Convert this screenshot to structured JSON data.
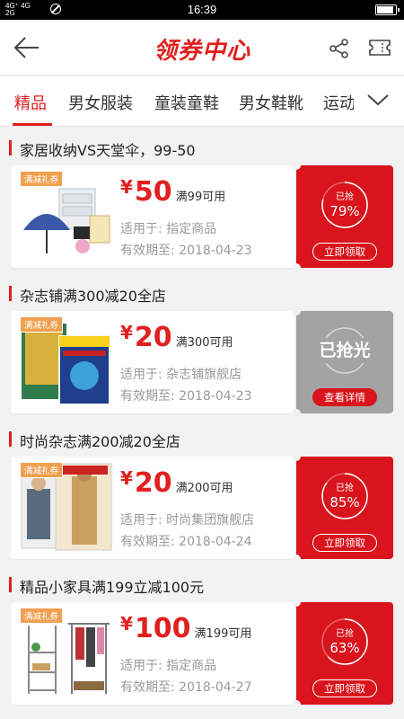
{
  "status_bar": {
    "signal1": "4G⁺ 4G",
    "signal2": "2G",
    "time": "16:39",
    "battery_level": 0.9
  },
  "header": {
    "logo": "领券中心",
    "icons": [
      "back-arrow-icon",
      "share-icon",
      "ticket-icon"
    ]
  },
  "tabs": [
    {
      "label": "精品",
      "active": true
    },
    {
      "label": "男女服装"
    },
    {
      "label": "童装童鞋"
    },
    {
      "label": "男女鞋靴"
    },
    {
      "label": "运动"
    }
  ],
  "coupons": [
    {
      "title": "家居收纳VS天堂伞，99-50",
      "tag": "满减礼券",
      "currency": "¥",
      "amount": "50",
      "condition": "满99可用",
      "apply": "适用于: 指定商品",
      "expiry": "有效期至: 2018-04-23",
      "status_label": "已抢",
      "percent_text": "79%",
      "percent": 0.79,
      "button": "立即领取",
      "sold_out": false
    },
    {
      "title": "杂志铺满300减20全店",
      "tag": "满减礼券",
      "currency": "¥",
      "amount": "20",
      "condition": "满300可用",
      "apply": "适用于: 杂志铺旗舰店",
      "expiry": "有效期至: 2018-04-23",
      "status_label": "已抢光",
      "button": "查看详情",
      "sold_out": true
    },
    {
      "title": "时尚杂志满200减20全店",
      "tag": "满减礼券",
      "currency": "¥",
      "amount": "20",
      "condition": "满200可用",
      "apply": "适用于: 时尚集团旗舰店",
      "expiry": "有效期至: 2018-04-24",
      "status_label": "已抢",
      "percent_text": "85%",
      "percent": 0.85,
      "button": "立即领取",
      "sold_out": false
    },
    {
      "title": "精品小家具满199立减100元",
      "tag": "满减礼券",
      "currency": "¥",
      "amount": "100",
      "condition": "满199可用",
      "apply": "适用于: 指定商品",
      "expiry": "有效期至: 2018-04-27",
      "status_label": "已抢",
      "percent_text": "63%",
      "percent": 0.63,
      "button": "立即领取",
      "sold_out": false
    }
  ],
  "colors": {
    "accent": "#e02020",
    "stub": "#d9141c",
    "sold_out": "#a3a3a3",
    "tag": "#f0a050"
  }
}
